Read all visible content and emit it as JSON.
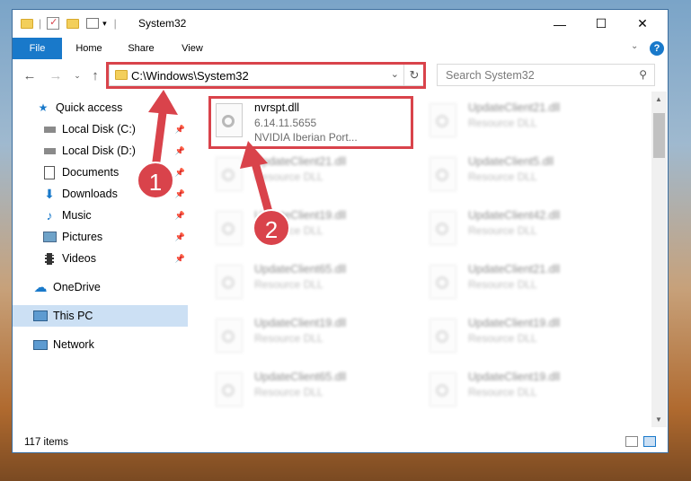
{
  "window": {
    "title": "System32",
    "minimize": "—",
    "maximize": "☐",
    "close": "✕"
  },
  "ribbon": {
    "tabs": [
      "File",
      "Home",
      "Share",
      "View"
    ],
    "help": "?"
  },
  "address": {
    "path": "C:\\Windows\\System32",
    "search_placeholder": "Search System32",
    "refresh": "↻"
  },
  "nav": {
    "items": [
      {
        "label": "Quick access"
      },
      {
        "label": "Local Disk (C:)"
      },
      {
        "label": "Local Disk (D:)"
      },
      {
        "label": "Documents"
      },
      {
        "label": "Downloads"
      },
      {
        "label": "Music"
      },
      {
        "label": "Pictures"
      },
      {
        "label": "Videos"
      },
      {
        "label": "OneDrive"
      },
      {
        "label": "This PC"
      },
      {
        "label": "Network"
      }
    ]
  },
  "files": {
    "highlighted": {
      "name": "nvrspt.dll",
      "version": "6.14.11.5655",
      "description": "NVIDIA Iberian Port..."
    },
    "blurred": [
      {
        "name": "UpdateClient21.dll",
        "type": "Resource DLL"
      },
      {
        "name": "UpdateClient21.dll",
        "type": "Resource DLL"
      },
      {
        "name": "UpdateClient5.dll",
        "type": "Resource DLL"
      },
      {
        "name": "UpdateClient19.dll",
        "type": "Resource DLL"
      },
      {
        "name": "UpdateClient42.dll",
        "type": "Resource DLL"
      },
      {
        "name": "UpdateClient65.dll",
        "type": "Resource DLL"
      },
      {
        "name": "UpdateClient21.dll",
        "type": "Resource DLL"
      },
      {
        "name": "UpdateClient19.dll",
        "type": "Resource DLL"
      },
      {
        "name": "UpdateClient19.dll",
        "type": "Resource DLL"
      },
      {
        "name": "UpdateClient65.dll",
        "type": "Resource DLL"
      },
      {
        "name": "UpdateClient19.dll",
        "type": "Resource DLL"
      }
    ]
  },
  "status": {
    "item_count": "117 items"
  },
  "callouts": [
    "1",
    "2"
  ],
  "colors": {
    "accent": "#1979ca",
    "highlight": "#d9434b",
    "selected": "#cce0f4"
  }
}
